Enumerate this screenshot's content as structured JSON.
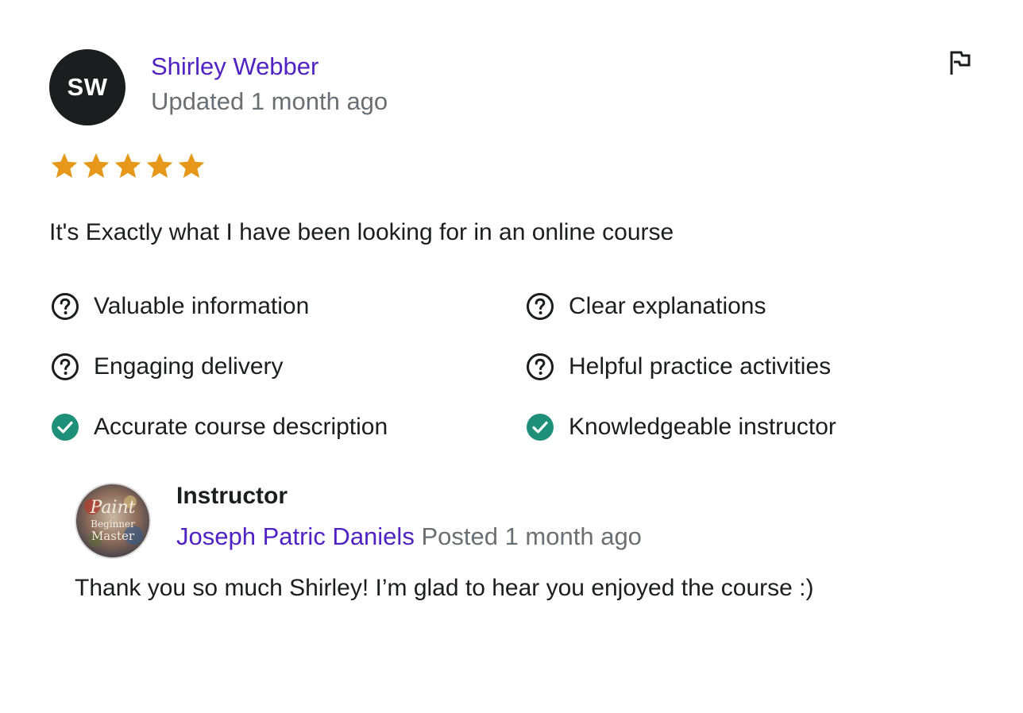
{
  "review": {
    "avatar_initials": "SW",
    "reviewer_name": "Shirley Webber",
    "meta": "Updated 1 month ago",
    "rating": 5,
    "rating_max": 5,
    "text": "It's Exactly what I have been looking for in an online course",
    "star_color": "#e59819",
    "flag_icon": "flag-icon"
  },
  "feedback": [
    {
      "label": "Valuable information",
      "status": "question",
      "icon": "question-circle-icon"
    },
    {
      "label": "Clear explanations",
      "status": "question",
      "icon": "question-circle-icon"
    },
    {
      "label": "Engaging delivery",
      "status": "question",
      "icon": "question-circle-icon"
    },
    {
      "label": "Helpful practice activities",
      "status": "question",
      "icon": "question-circle-icon"
    },
    {
      "label": "Accurate course description",
      "status": "check",
      "icon": "check-circle-icon"
    },
    {
      "label": "Knowledgeable instructor",
      "status": "check",
      "icon": "check-circle-icon"
    }
  ],
  "instructor": {
    "role_label": "Instructor",
    "name": "Joseph Patric Daniels",
    "meta": "Posted 1 month ago",
    "reply_text": "Thank you so much Shirley! I’m glad to hear you enjoyed the course :)",
    "avatar_logo_text": [
      "Paint",
      "Beginner",
      "Master"
    ]
  },
  "colors": {
    "link": "#5022c3",
    "muted": "#6a6f73",
    "check": "#1e9079",
    "text": "#1c1d1f"
  }
}
